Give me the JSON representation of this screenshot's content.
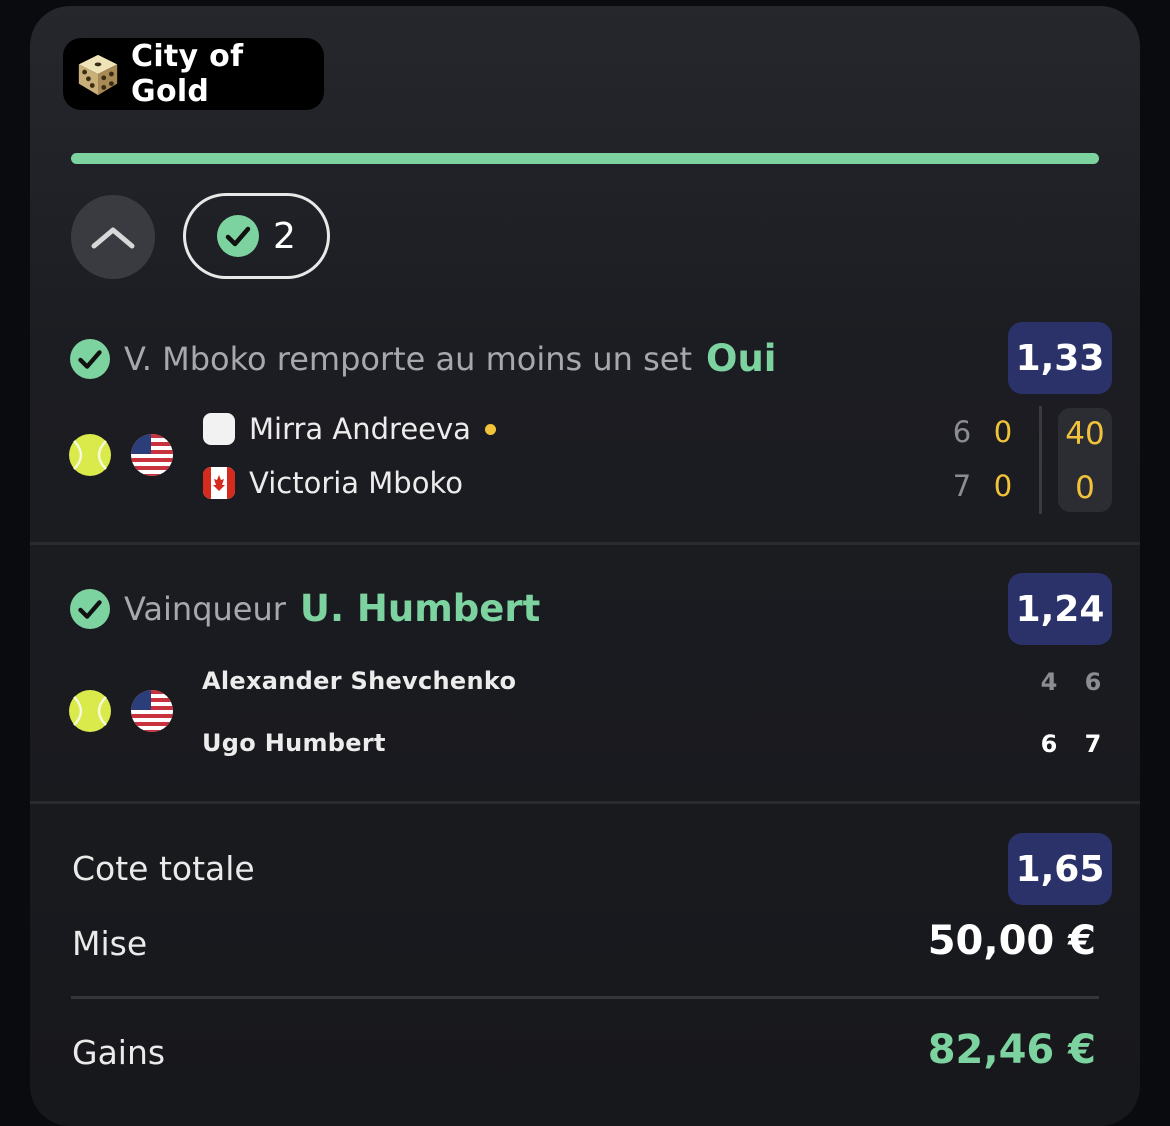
{
  "header": {
    "game_icon": "dice-icon",
    "game_name": "City of Gold"
  },
  "progress": {
    "fraction": 1.0,
    "color": "#7dd3a0"
  },
  "controls": {
    "collapse_icon": "chevron-up-icon",
    "won_count": "2"
  },
  "bets": [
    {
      "status_icon": "check-circle-icon",
      "market": "V. Mboko remporte au moins un set",
      "selection": "Oui",
      "odds": "1,33",
      "sport_icon": "tennis-ball-icon",
      "country_flag": "us-flag-icon",
      "players": [
        {
          "name": "Mirra Andreeva",
          "flag": "neutral-flag-icon",
          "serving": true,
          "sets": [
            "6",
            "0"
          ],
          "game": "40"
        },
        {
          "name": "Victoria Mboko",
          "flag": "canada-flag-icon",
          "serving": false,
          "sets": [
            "7",
            "0"
          ],
          "game": "0"
        }
      ]
    },
    {
      "status_icon": "check-circle-icon",
      "market": "Vainqueur",
      "selection": "U. Humbert",
      "odds": "1,24",
      "sport_icon": "tennis-ball-icon",
      "country_flag": "us-flag-icon",
      "players": [
        {
          "name": "Alexander Shevchenko",
          "sets": [
            "4",
            "6"
          ]
        },
        {
          "name": "Ugo Humbert",
          "sets": [
            "6",
            "7"
          ]
        }
      ]
    }
  ],
  "summary": {
    "total_odds_label": "Cote totale",
    "total_odds": "1,65",
    "stake_label": "Mise",
    "stake": "50,00 €",
    "winnings_label": "Gains",
    "winnings": "82,46 €"
  },
  "colors": {
    "accent_green": "#7dd3a0",
    "odds_bg": "#2a3269",
    "live_gold": "#f2c33a"
  }
}
